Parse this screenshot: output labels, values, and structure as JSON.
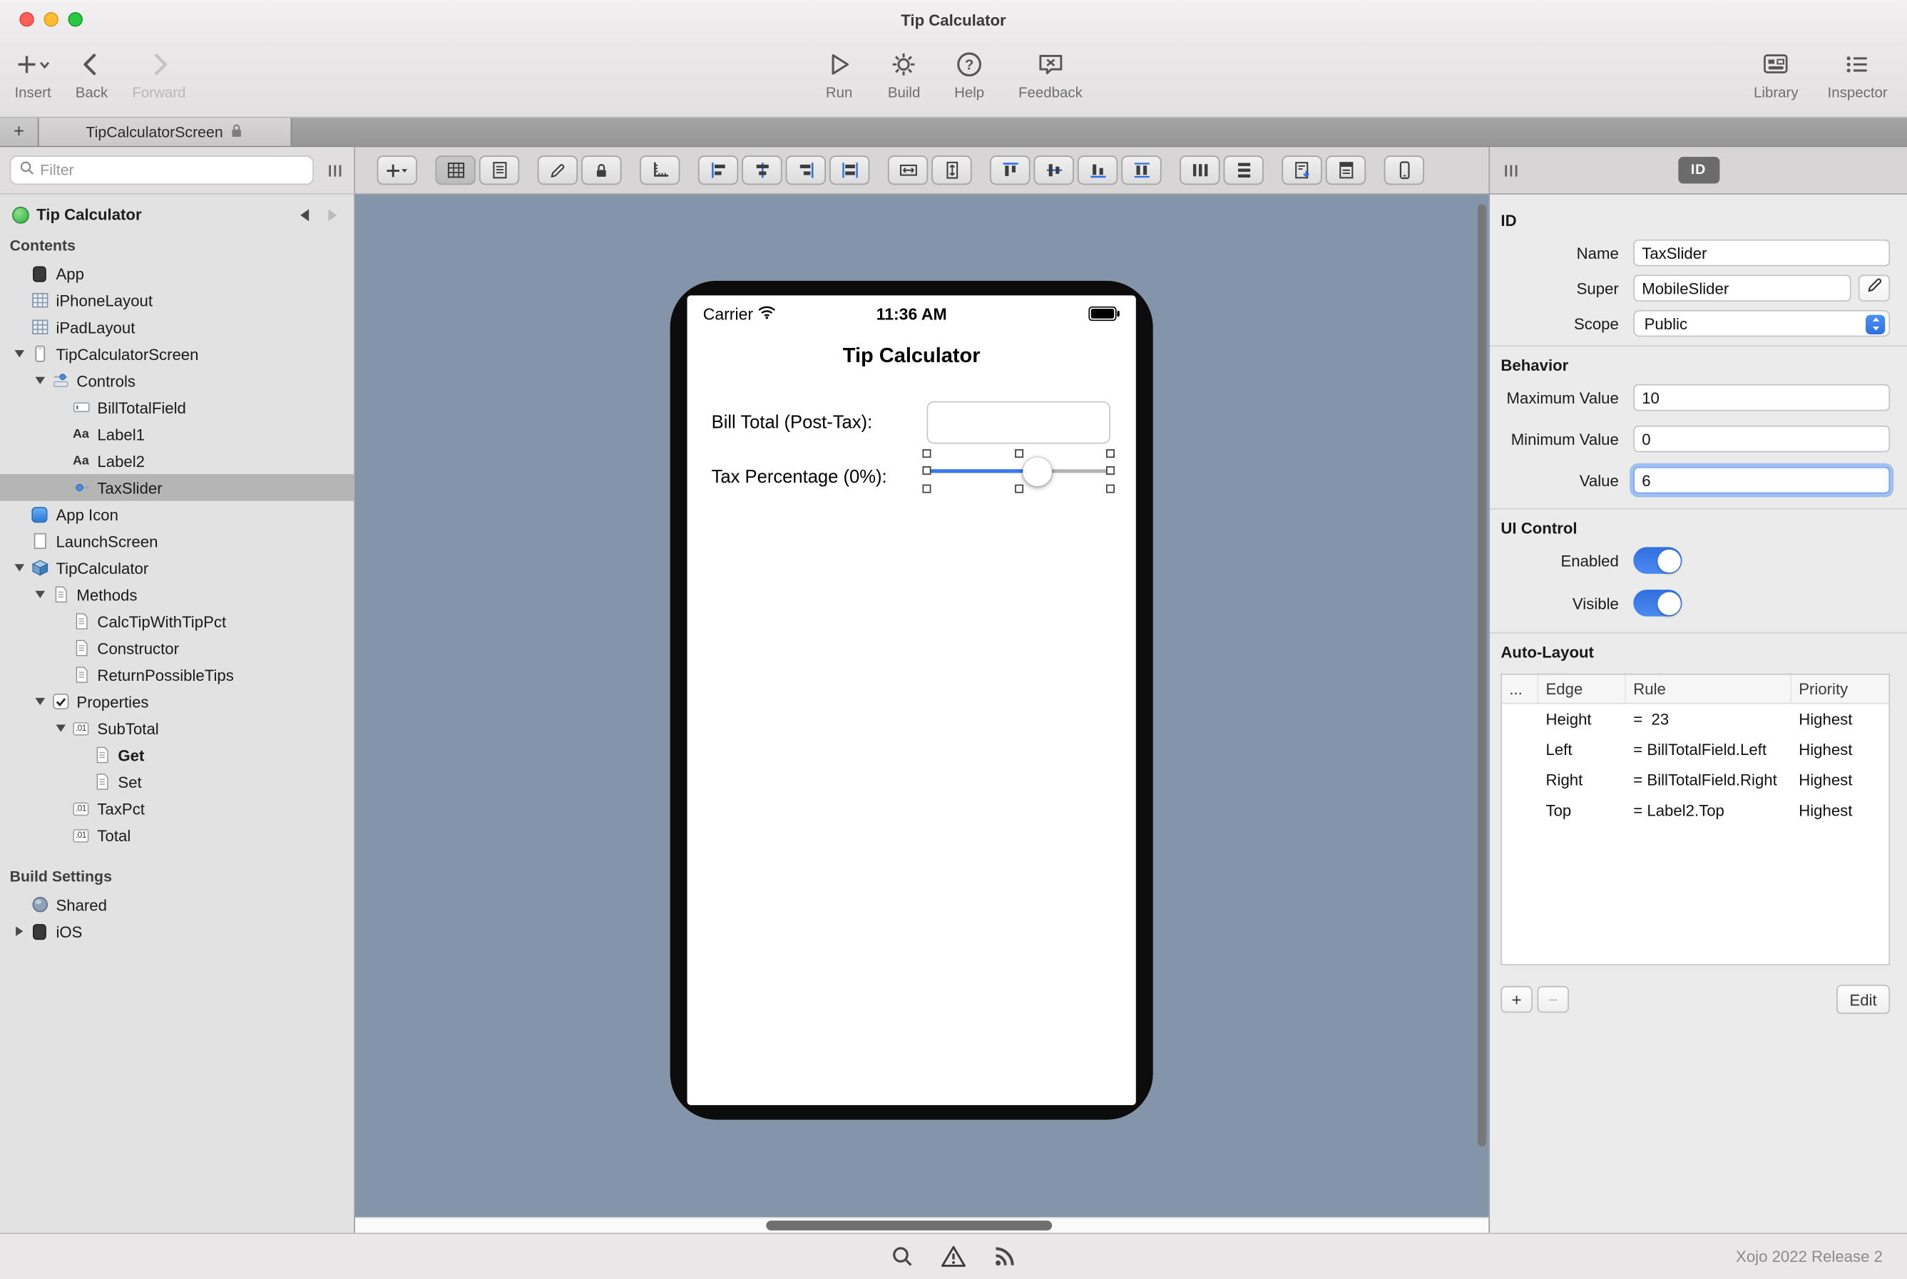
{
  "window": {
    "title": "Tip Calculator"
  },
  "toolbar": {
    "left": [
      {
        "id": "insert",
        "label": "Insert",
        "icon": "insert-plus-icon",
        "enabled": true
      },
      {
        "id": "back",
        "label": "Back",
        "icon": "chevron-left-icon",
        "enabled": true
      },
      {
        "id": "forward",
        "label": "Forward",
        "icon": "chevron-right-icon",
        "enabled": false
      }
    ],
    "center": [
      {
        "id": "run",
        "label": "Run",
        "icon": "play-icon",
        "enabled": true
      },
      {
        "id": "build",
        "label": "Build",
        "icon": "gear-icon",
        "enabled": true
      },
      {
        "id": "help",
        "label": "Help",
        "icon": "help-icon",
        "enabled": true
      },
      {
        "id": "feedback",
        "label": "Feedback",
        "icon": "feedback-icon",
        "enabled": true
      }
    ],
    "right": [
      {
        "id": "library",
        "label": "Library",
        "icon": "library-icon",
        "enabled": true
      },
      {
        "id": "inspector",
        "label": "Inspector",
        "icon": "inspector-icon",
        "enabled": true
      }
    ]
  },
  "tabs": [
    {
      "label": "+",
      "type": "new",
      "active": false
    },
    {
      "label": "TipCalculatorScreen",
      "type": "document",
      "active": true,
      "locked": true
    }
  ],
  "navigator": {
    "filter_placeholder": "Filter",
    "project": {
      "name": "Tip Calculator"
    },
    "items": [
      {
        "type": "header",
        "label": "Contents"
      },
      {
        "type": "item",
        "label": "App",
        "icon": "app",
        "level": 0
      },
      {
        "type": "item",
        "label": "iPhoneLayout",
        "icon": "layout",
        "level": 0
      },
      {
        "type": "item",
        "label": "iPadLayout",
        "icon": "layout",
        "level": 0
      },
      {
        "type": "item",
        "label": "TipCalculatorScreen",
        "icon": "screen",
        "level": 0,
        "disclosure": "open"
      },
      {
        "type": "item",
        "label": "Controls",
        "icon": "controls",
        "level": 1,
        "disclosure": "open"
      },
      {
        "type": "item",
        "label": "BillTotalField",
        "icon": "textfield",
        "level": 2
      },
      {
        "type": "item",
        "label": "Label1",
        "icon": "label",
        "level": 2
      },
      {
        "type": "item",
        "label": "Label2",
        "icon": "label",
        "level": 2
      },
      {
        "type": "item",
        "label": "TaxSlider",
        "icon": "slider",
        "level": 2,
        "selected": true
      },
      {
        "type": "item",
        "label": "App Icon",
        "icon": "appicon",
        "level": 0
      },
      {
        "type": "item",
        "label": "LaunchScreen",
        "icon": "launchscreen",
        "level": 0
      },
      {
        "type": "item",
        "label": "TipCalculator",
        "icon": "class",
        "level": 0,
        "disclosure": "open"
      },
      {
        "type": "item",
        "label": "Methods",
        "icon": "method",
        "level": 1,
        "disclosure": "open"
      },
      {
        "type": "item",
        "label": "CalcTipWithTipPct",
        "icon": "method",
        "level": 2
      },
      {
        "type": "item",
        "label": "Constructor",
        "icon": "method",
        "level": 2
      },
      {
        "type": "item",
        "label": "ReturnPossibleTips",
        "icon": "method",
        "level": 2
      },
      {
        "type": "item",
        "label": "Properties",
        "icon": "properties",
        "level": 1,
        "disclosure": "open"
      },
      {
        "type": "item",
        "label": "SubTotal",
        "icon": "property",
        "level": 2,
        "disclosure": "open"
      },
      {
        "type": "item",
        "label": "Get",
        "icon": "getset",
        "level": 3,
        "bold": true
      },
      {
        "type": "item",
        "label": "Set",
        "icon": "getset",
        "level": 3
      },
      {
        "type": "item",
        "label": "TaxPct",
        "icon": "property",
        "level": 2
      },
      {
        "type": "item",
        "label": "Total",
        "icon": "property",
        "level": 2
      },
      {
        "type": "header",
        "label": "Build Settings"
      },
      {
        "type": "item",
        "label": "Shared",
        "icon": "shared",
        "level": 0
      },
      {
        "type": "item",
        "label": "iOS",
        "icon": "ios",
        "level": 0,
        "disclosure": "closed"
      }
    ]
  },
  "editor_toolbar": {
    "groups": [
      [
        {
          "icon": "add-control-icon"
        }
      ],
      [
        {
          "icon": "grid-view-icon",
          "active": true
        },
        {
          "icon": "list-view-icon"
        }
      ],
      [
        {
          "icon": "pencil-icon"
        },
        {
          "icon": "lock-icon"
        }
      ],
      [
        {
          "icon": "ruler-icon"
        }
      ],
      [
        {
          "icon": "align-left-icon"
        },
        {
          "icon": "align-center-icon"
        },
        {
          "icon": "align-right-icon"
        },
        {
          "icon": "align-edges-icon"
        }
      ],
      [
        {
          "icon": "equal-width-icon"
        },
        {
          "icon": "equal-height-icon"
        }
      ],
      [
        {
          "icon": "align-top-icon"
        },
        {
          "icon": "align-middle-icon"
        },
        {
          "icon": "align-bottom-icon"
        },
        {
          "icon": "align-baseline-icon"
        }
      ],
      [
        {
          "icon": "distribute-horizontal-icon"
        },
        {
          "icon": "distribute-vertical-icon"
        }
      ],
      [
        {
          "icon": "export-layout-icon"
        },
        {
          "icon": "report-icon"
        }
      ],
      [
        {
          "icon": "device-preview-icon"
        }
      ]
    ]
  },
  "canvas": {
    "phone": {
      "carrier": "Carrier",
      "time": "11:36 AM",
      "title": "Tip Calculator",
      "bill_label": "Bill Total (Post-Tax):",
      "bill_value": "",
      "tax_label": "Tax Percentage (0%):",
      "slider": {
        "value": 6,
        "min": 0,
        "max": 10
      }
    }
  },
  "inspector": {
    "tab_label": "ID",
    "id_section": {
      "title": "ID",
      "rows": [
        {
          "label": "Name",
          "value": "TaxSlider",
          "type": "text"
        },
        {
          "label": "Super",
          "value": "MobileSlider",
          "type": "text-edit"
        },
        {
          "label": "Scope",
          "value": "Public",
          "type": "popup"
        }
      ]
    },
    "behavior_section": {
      "title": "Behavior",
      "rows": [
        {
          "label": "Maximum Value",
          "value": "10",
          "focused": false
        },
        {
          "label": "Minimum Value",
          "value": "0",
          "focused": false
        },
        {
          "label": "Value",
          "value": "6",
          "focused": true
        }
      ]
    },
    "ui_control_section": {
      "title": "UI Control",
      "toggles": [
        {
          "label": "Enabled",
          "on": true
        },
        {
          "label": "Visible",
          "on": true
        }
      ]
    },
    "auto_layout_section": {
      "title": "Auto-Layout",
      "columns": [
        "...",
        "Edge",
        "Rule",
        "Priority"
      ],
      "rows": [
        {
          "edge": "Height",
          "rule": "=  23",
          "priority": "Highest"
        },
        {
          "edge": "Left",
          "rule": "= BillTotalField.Left",
          "priority": "Highest"
        },
        {
          "edge": "Right",
          "rule": "= BillTotalField.Right",
          "priority": "Highest"
        },
        {
          "edge": "Top",
          "rule": "= Label2.Top",
          "priority": "Highest"
        }
      ],
      "add_label": "+",
      "remove_label": "−",
      "edit_label": "Edit"
    }
  },
  "statusbar": {
    "icons": [
      "search-icon",
      "warning-icon",
      "feed-icon"
    ],
    "version": "Xojo 2022 Release 2"
  },
  "colors": {
    "accent_blue": "#3478f6",
    "canvas_slate": "#8494a9",
    "selection_gray": "#b5b5b5",
    "toggle_on": "#2f6fe0"
  }
}
